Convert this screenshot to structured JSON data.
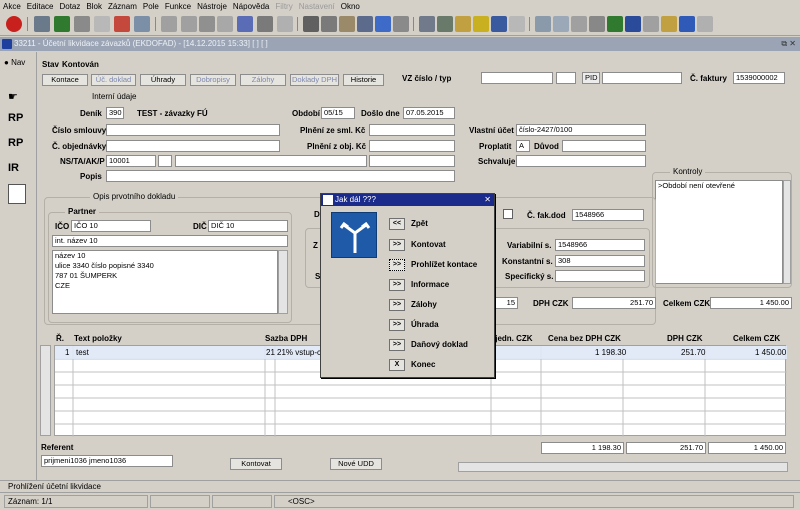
{
  "menu": [
    "Akce",
    "Editace",
    "Dotaz",
    "Blok",
    "Záznam",
    "Pole",
    "Funkce",
    "Nástroje",
    "Nápověda",
    "Filtry",
    "Nastavení",
    "Okno"
  ],
  "menu_disabled": [
    "Filtry",
    "Nastavení"
  ],
  "window_title": "33211 - Účetní likvidace závazků (EKDOFAD) - [14.12.2015 15:33]  [ ] [ ]",
  "left_nav": {
    "nav_label": "Nav",
    "icons": [
      "RP",
      "RP",
      "IR"
    ]
  },
  "header": {
    "stav_label": "Stav",
    "stav_value": "Kontován",
    "vz_label": "VZ číslo / typ",
    "pid_label": "PID",
    "faktura_label": "Č. faktury",
    "faktura_value": "1539000002"
  },
  "tabs": [
    "Kontace",
    "Úč. doklad",
    "Úhrady",
    "Dobropisy",
    "Zálohy",
    "Doklady DPH",
    "Historie"
  ],
  "interni": {
    "title": "Interní údaje",
    "denik_label": "Deník",
    "denik_code": "390",
    "denik_name": "TEST - závazky FÚ",
    "obdobi_label": "Období",
    "obdobi_value": "05/15",
    "doslo_label": "Došlo dne",
    "doslo_value": "07.05.2015",
    "smlouva_label": "Číslo smlouvy",
    "plneni_sml_label": "Plnění ze sml. Kč",
    "vlastni_label": "Vlastní účet",
    "vlastni_value": "číslo-2427/0100",
    "objednavka_label": "Č. objednávky",
    "plneni_obj_label": "Plnění z obj. Kč",
    "proplatit_label": "Proplatit",
    "proplatit_value": "A",
    "duvod_label": "Důvod",
    "nsta_label": "NS/TA/AK/P",
    "nsta_value": "10001",
    "schvaluje_label": "Schvaluje",
    "popis_label": "Popis"
  },
  "kontroly": {
    "title": "Kontroly",
    "text": ">Období není otevřené"
  },
  "opis": {
    "title": "Opis prvotního dokladu",
    "partner_title": "Partner",
    "ico_label": "IČO",
    "ico_value": "IČO 10",
    "dic_label": "DIČ",
    "dic_value": "DIČ 10",
    "name": "int. název 10",
    "address": [
      "název 10",
      "ulice 3340 číslo popisné 3340",
      "787 01 ŠUMPERK",
      "CZE"
    ]
  },
  "right_fields": {
    "cfak_label": "Č. fak.dod",
    "cfak_value": "1548966",
    "variabilni_label": "Variabilní s.",
    "variabilni_value": "1548966",
    "konstantni_label": "Konstantní s.",
    "konstantni_value": "308",
    "specificky_label": "Specifický s.",
    "num15": "15",
    "dph_czk_label": "DPH CZK",
    "dph_czk_value": "251.70",
    "celkem_czk_label": "Celkem CZK",
    "celkem_czk_value": "1 450.00"
  },
  "table": {
    "headers": {
      "r": "Ř.",
      "text": "Text položky",
      "sazba": "Sazba DPH",
      "jedn": "/jedn.  CZK",
      "cena": "Cena bez DPH  CZK",
      "dph": "DPH  CZK",
      "celkem": "Celkem  CZK"
    },
    "row": {
      "r": "1",
      "text": "test",
      "sazba_code": "21",
      "sazba_text": "21% vstup-c",
      "cena": "1 198.30",
      "dph": "251.70",
      "celkem": "1 450.00"
    },
    "totals": {
      "cena": "1 198.30",
      "dph": "251.70",
      "celkem": "1 450.00"
    }
  },
  "referent": {
    "label": "Referent",
    "value": "prijmeni1036 jmeno1036",
    "kontovat": "Kontovat",
    "nove_udd": "Nové UDD"
  },
  "dialog": {
    "title": "Jak dál ???",
    "options": [
      {
        "btn": "<<",
        "label": "Zpět"
      },
      {
        "btn": ">>",
        "label": "Kontovat"
      },
      {
        "btn": ">>",
        "label": "Prohlížet kontace"
      },
      {
        "btn": ">>",
        "label": "Informace"
      },
      {
        "btn": ">>",
        "label": "Zálohy"
      },
      {
        "btn": ">>",
        "label": "Úhrada"
      },
      {
        "btn": ">>",
        "label": "Daňový doklad"
      },
      {
        "btn": "X",
        "label": "Konec"
      }
    ]
  },
  "status": {
    "line1": "Prohlížení účetní likvidace",
    "record": "Záznam: 1/1",
    "osc": "<OSC>"
  }
}
